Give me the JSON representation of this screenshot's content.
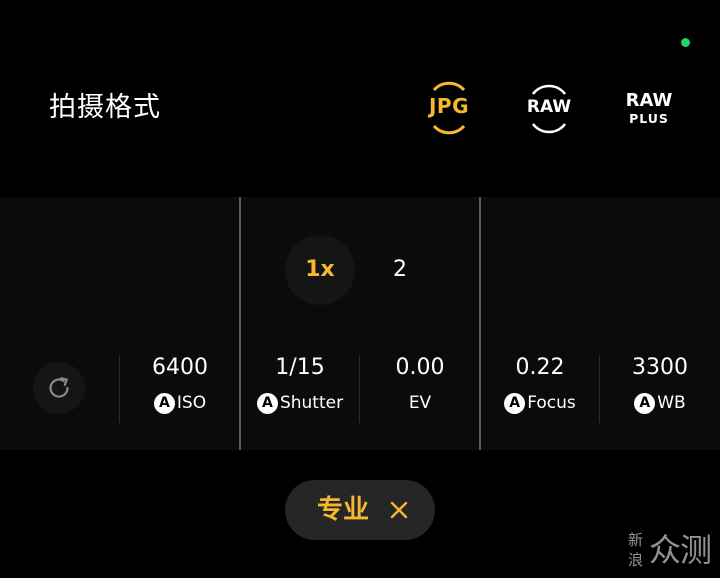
{
  "colors": {
    "accent": "#f5b82e",
    "status_dot": "#22d36a",
    "text": "#ffffff"
  },
  "header": {
    "title": "拍摄格式",
    "formats": [
      {
        "label": "JPG",
        "selected": true
      },
      {
        "label": "RAW",
        "selected": false
      },
      {
        "label_top": "RAW",
        "label_bottom": "PLUS",
        "selected": false
      }
    ]
  },
  "zoom": {
    "active": "1x",
    "other": "2"
  },
  "reset": {
    "icon": "refresh-icon"
  },
  "params": [
    {
      "value": "6400",
      "auto": "A",
      "label": "ISO"
    },
    {
      "value": "1/15",
      "auto": "A",
      "label": "Shutter"
    },
    {
      "value": "0.00",
      "label": "EV"
    },
    {
      "value": "0.22",
      "auto": "A",
      "label": "Focus"
    },
    {
      "value": "3300",
      "auto": "A",
      "label": "WB"
    }
  ],
  "mode": {
    "label": "专业",
    "close_icon": "close-icon"
  },
  "watermark": {
    "small_top": "新",
    "small_bottom": "浪",
    "big": "众测"
  }
}
